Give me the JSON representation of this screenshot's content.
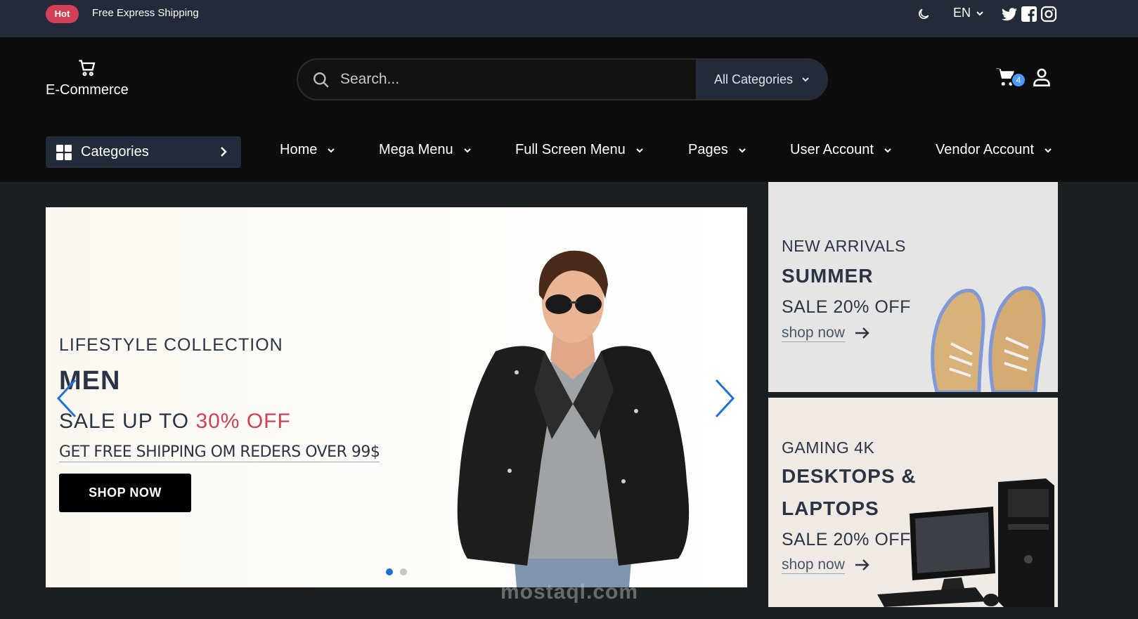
{
  "topbar": {
    "badge": "Hot",
    "shipping_text": "Free Express Shipping",
    "language": "EN",
    "icons": [
      "moon-icon",
      "twitter-icon",
      "facebook-icon",
      "instagram-icon"
    ]
  },
  "header": {
    "logo_text": "E-Commerce",
    "search_placeholder": "Search...",
    "category_dropdown": "All Categories",
    "cart_count": "4"
  },
  "nav": {
    "categories_label": "Categories",
    "items": [
      "Home",
      "Mega Menu",
      "Full Screen Menu",
      "Pages",
      "User Account",
      "Vendor Account"
    ]
  },
  "hero": {
    "eyebrow": "LIFESTYLE COLLECTION",
    "title": "MEN",
    "sale_prefix": "SALE UP TO ",
    "sale_accent": "30% OFF",
    "shipping_note": "GET FREE SHIPPING OM REDERS OVER 99$",
    "cta": "SHOP NOW"
  },
  "promos": [
    {
      "eyebrow": "NEW ARRIVALS",
      "title": "SUMMER",
      "sale": "SALE 20% OFF",
      "link": "shop now"
    },
    {
      "eyebrow": "GAMING 4K",
      "title_line1": "DESKTOPS &",
      "title_line2": "LAPTOPS",
      "sale": "SALE 20% OFF",
      "link": "shop now"
    }
  ],
  "watermark": "mostaql.com",
  "colors": {
    "topbar_bg": "#232b3b",
    "header_bg": "#0d0d0d",
    "accent_red": "#d23f57",
    "accent_blue": "#4e97fd",
    "text_dark": "#2b3445"
  }
}
